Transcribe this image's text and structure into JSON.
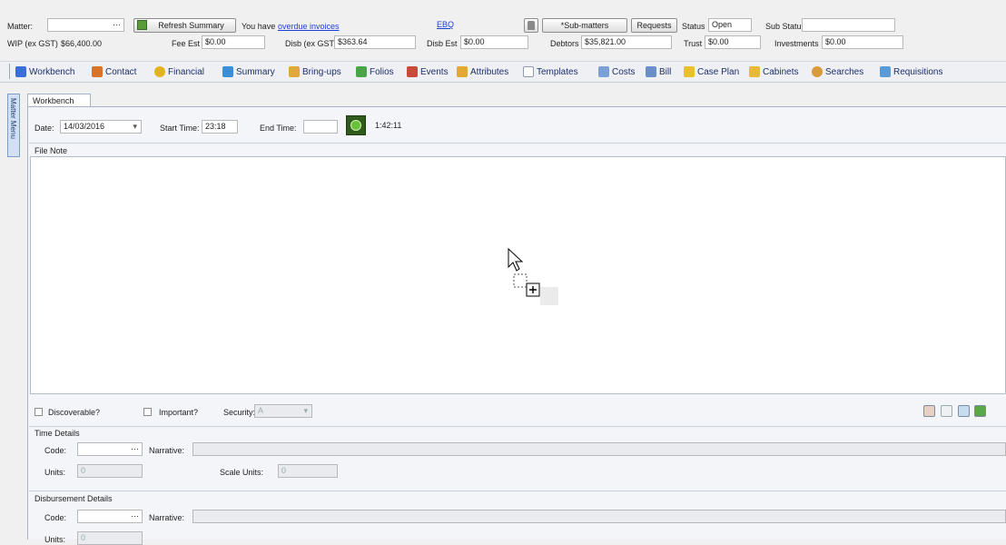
{
  "header": {
    "matter_label": "Matter:",
    "matter_value": "",
    "ellipsis": "···",
    "refresh_label": "Refresh Summary",
    "you_have": "You have",
    "overdue_link": "overdue invoices",
    "ebq_link": "EBQ",
    "submatters_label": "*Sub-matters",
    "requests_label": "Requests",
    "status_label": "Status",
    "status_value": "Open",
    "substatus_label": "Sub Status",
    "substatus_value": ""
  },
  "summary": {
    "wip_label": "WIP (ex GST)",
    "wip_value": "$66,400.00",
    "fee_est_label": "Fee Est",
    "fee_est_value": "$0.00",
    "disb_label": "Disb (ex GST)",
    "disb_value": "$363.64",
    "disb_est_label": "Disb Est",
    "disb_est_value": "$0.00",
    "debtors_label": "Debtors",
    "debtors_value": "$35,821.00",
    "trust_label": "Trust",
    "trust_value": "$0.00",
    "investments_label": "Investments",
    "investments_value": "$0.00"
  },
  "nav": [
    {
      "label": "Workbench",
      "icon": "pencil-icon",
      "color": "#3a6fd8"
    },
    {
      "label": "Contact",
      "icon": "people-icon",
      "color": "#d8742a"
    },
    {
      "label": "Financial",
      "icon": "coins-icon",
      "color": "#e3b21f"
    },
    {
      "label": "Summary",
      "icon": "monitor-icon",
      "color": "#3c8fd6"
    },
    {
      "label": "Bring-ups",
      "icon": "folder-clock-icon",
      "color": "#e0a83a"
    },
    {
      "label": "Folios",
      "icon": "books-icon",
      "color": "#4aa44a"
    },
    {
      "label": "Events",
      "icon": "people-events-icon",
      "color": "#c84a3a"
    },
    {
      "label": "Attributes",
      "icon": "folder-attr-icon",
      "color": "#e3a832"
    },
    {
      "label": "Templates",
      "icon": "document-icon",
      "color": "#ffffff"
    },
    {
      "label": "Costs",
      "icon": "costs-icon",
      "color": "#7aa0d8"
    },
    {
      "label": "Bill",
      "icon": "bill-icon",
      "color": "#6a8fc8"
    },
    {
      "label": "Case Plan",
      "icon": "caseplan-icon",
      "color": "#e8c02e"
    },
    {
      "label": "Cabinets",
      "icon": "cabinet-icon",
      "color": "#e8b83a"
    },
    {
      "label": "Searches",
      "icon": "search-icon",
      "color": "#d89a3a"
    },
    {
      "label": "Requisitions",
      "icon": "requisition-icon",
      "color": "#5a9ad8"
    }
  ],
  "side_tab": "Matter Menu",
  "tab_workbench": "Workbench",
  "workbench": {
    "date_label": "Date:",
    "date_value": "14/03/2016",
    "start_label": "Start Time:",
    "start_value": "23:18",
    "end_label": "End Time:",
    "end_value": "",
    "timer_value": "1:42:11",
    "file_note_label": "File Note",
    "file_note_value": ""
  },
  "options": {
    "discoverable_label": "Discoverable?",
    "important_label": "Important?",
    "security_label": "Security:",
    "security_value": "A"
  },
  "time_details": {
    "title": "Time Details",
    "code_label": "Code:",
    "code_value": "",
    "narrative_label": "Narrative:",
    "narrative_value": "",
    "units_label": "Units:",
    "units_value": "0",
    "scale_units_label": "Scale Units:",
    "scale_units_value": "0"
  },
  "disbursement_details": {
    "title": "Disbursement Details",
    "code_label": "Code:",
    "code_value": "",
    "narrative_label": "Narrative:",
    "narrative_value": "",
    "units_label": "Units:",
    "units_value": "0"
  }
}
